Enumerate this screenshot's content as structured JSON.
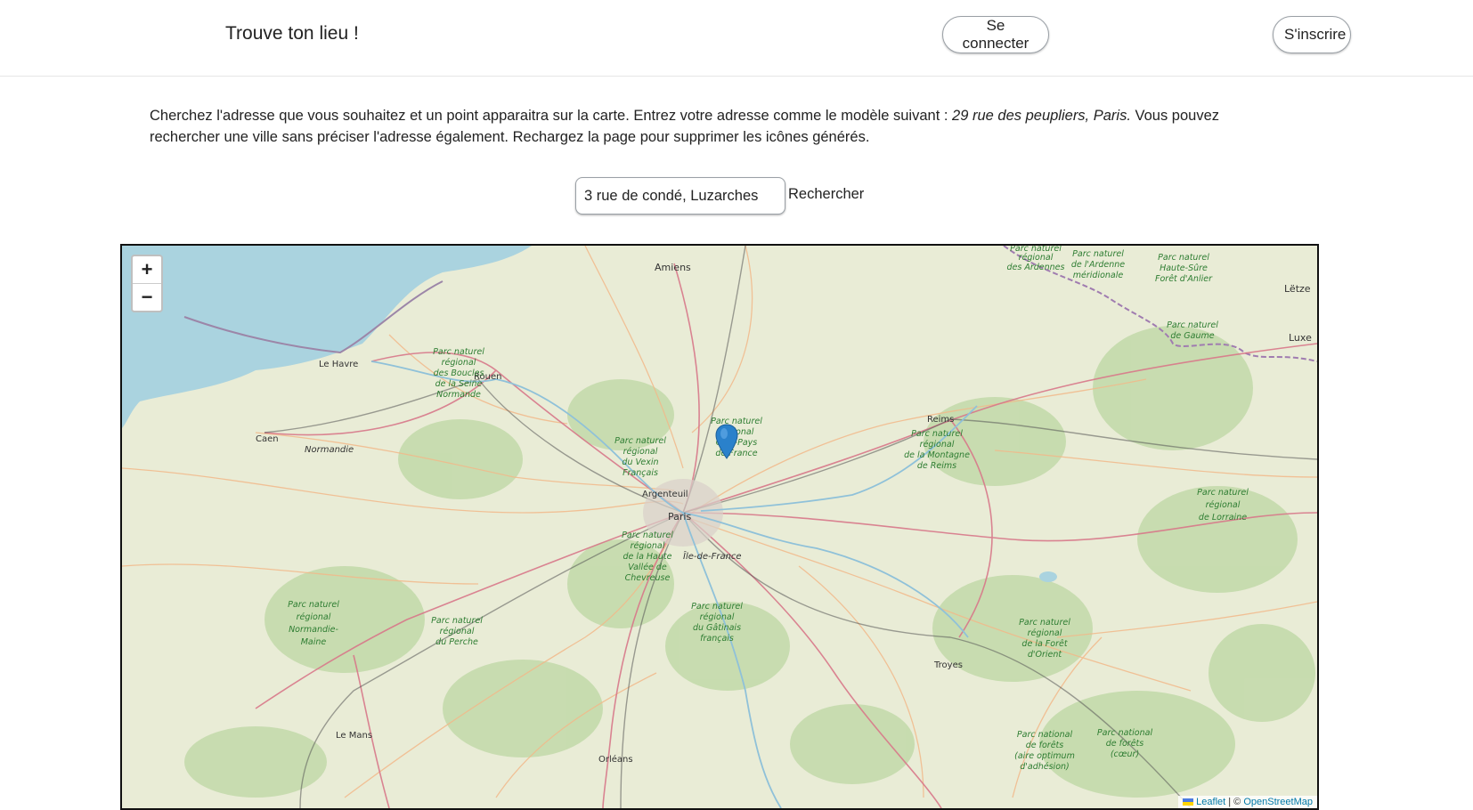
{
  "header": {
    "brand": "Trouve ton lieu !",
    "login_label": "Se connecter",
    "signup_label": "S'inscrire"
  },
  "intro": {
    "text_before": "Cherchez l'adresse que vous souhaitez et un point apparaitra sur la carte. Entrez votre adresse comme le modèle suivant : ",
    "example": "29 rue des peupliers, Paris.",
    "text_after": " Vous pouvez rechercher une ville sans préciser l'adresse également. Rechargez la page pour supprimer les icônes générés."
  },
  "search": {
    "value": "3 rue de condé, Luzarches",
    "button_label": "Rechercher"
  },
  "map": {
    "zoom_in": "+",
    "zoom_out": "−",
    "attribution": {
      "leaflet": "Leaflet",
      "separator": " | © ",
      "osm": "OpenStreetMap"
    },
    "labels": {
      "amiens": "Amiens",
      "le_havre": "Le Havre",
      "rouen": "Rouen",
      "caen": "Caen",
      "normandie": "Normandie",
      "reims": "Reims",
      "argenteuil": "Argenteuil",
      "paris": "Paris",
      "ile_de_france": "Île-de-France",
      "troyes": "Troyes",
      "le_mans": "Le Mans",
      "orleans": "Orléans",
      "letze": "Lëtze",
      "luxe": "Luxe"
    },
    "parks": {
      "boucles": [
        "Parc naturel",
        "régional",
        "des Boucles",
        "de la Seine",
        "Normande"
      ],
      "vexin": [
        "Parc naturel",
        "régional",
        "du Vexin",
        "Français"
      ],
      "oise": [
        "Parc naturel",
        "régional",
        "Oise-Pays",
        "de France"
      ],
      "montagne_reims": [
        "Parc naturel",
        "régional",
        "de la Montagne",
        "de Reims"
      ],
      "ardennes": [
        "Parc naturel",
        "régional",
        "des Ardennes"
      ],
      "ardenne_meridionale": [
        "Parc naturel",
        "de l'Ardenne",
        "méridionale"
      ],
      "haute_sure": [
        "Parc naturel",
        "Haute-Sûre",
        "Forêt d'Anlier"
      ],
      "gaume": [
        "Parc naturel",
        "de Gaume"
      ],
      "lorraine": [
        "Parc naturel",
        "régional",
        "de Lorraine"
      ],
      "chevreuse": [
        "Parc naturel",
        "régional",
        "de la Haute",
        "Vallée de",
        "Chevreuse"
      ],
      "normandie_maine": [
        "Parc naturel",
        "régional",
        "Normandie-",
        "Maine"
      ],
      "perche": [
        "Parc naturel",
        "régional",
        "du Perche"
      ],
      "gatinais": [
        "Parc naturel",
        "régional",
        "du Gâtinais",
        "français"
      ],
      "foret_orient": [
        "Parc naturel",
        "régional",
        "de la Forêt",
        "d'Orient"
      ],
      "forets_aine": [
        "Parc national",
        "de forêts",
        "(aire optimum",
        "d'adhésion)"
      ],
      "forets_coeur": [
        "Parc national",
        "de forêts",
        "(cœur)"
      ]
    },
    "colors": {
      "sea": "#aad3df",
      "land": "#e9ecd6",
      "forest": "#b9d5a0",
      "road_primary": "#d8788a",
      "road_secondary": "#f2b98a",
      "marker": "#2a81cb"
    }
  }
}
